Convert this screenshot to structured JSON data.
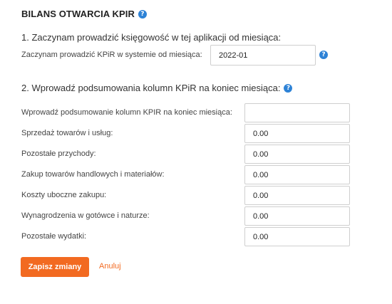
{
  "title": "BILANS OTWARCIA KPIR",
  "help_glyph": "?",
  "section1": {
    "heading": "1. Zaczynam prowadzić księgowość w tej aplikacji od miesiąca:",
    "label": "Zaczynam prowadzić KPiR w systemie od miesiąca:",
    "value": "2022-01"
  },
  "section2": {
    "heading": "2. Wprowadź podsumowania kolumn KPiR na koniec miesiąca:"
  },
  "form": {
    "rows": [
      {
        "label": "Wprowadź podsumowanie kolumn KPIR na koniec miesiąca:",
        "value": ""
      },
      {
        "label": "Sprzedaż towarów i usług:",
        "value": "0.00"
      },
      {
        "label": "Pozostałe przychody:",
        "value": "0.00"
      },
      {
        "label": "Zakup towarów handlowych i materiałów:",
        "value": "0.00"
      },
      {
        "label": "Koszty uboczne zakupu:",
        "value": "0.00"
      },
      {
        "label": "Wynagrodzenia w gotówce i naturze:",
        "value": "0.00"
      },
      {
        "label": "Pozostałe wydatki:",
        "value": "0.00"
      }
    ]
  },
  "actions": {
    "save_label": "Zapisz zmiany",
    "cancel_label": "Anuluj"
  },
  "colors": {
    "accent": "#f26a21",
    "help": "#2d82d6"
  }
}
